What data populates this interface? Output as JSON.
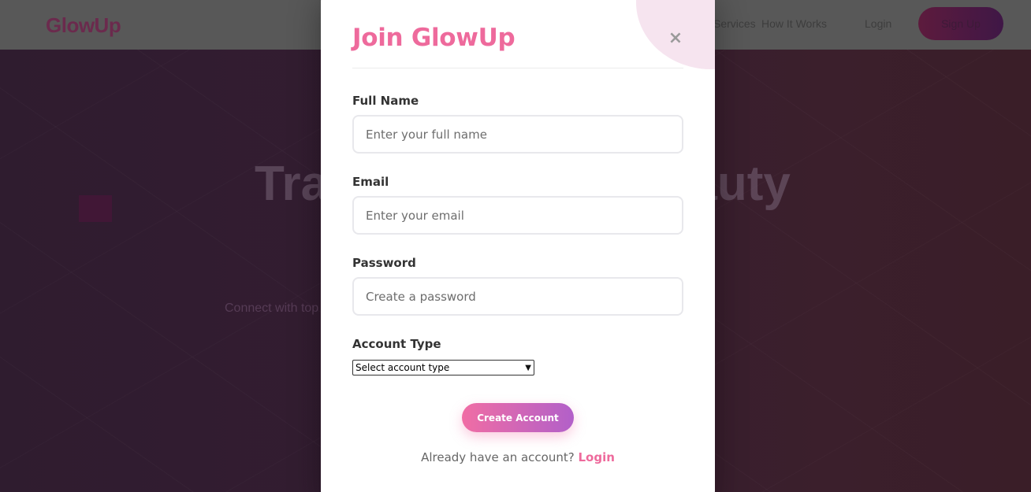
{
  "navbar": {
    "logo": "GlowUp",
    "links": [
      "Services",
      "How It Works",
      "Login"
    ],
    "signup_label": "Sign Up"
  },
  "hero": {
    "title": "Transform Your Beauty",
    "subtitle": "Connect with top beauty professionals and book appointments for"
  },
  "modal": {
    "title": "Join GlowUp",
    "close_symbol": "×",
    "fields": {
      "full_name": {
        "label": "Full Name",
        "placeholder": "Enter your full name"
      },
      "email": {
        "label": "Email",
        "placeholder": "Enter your email"
      },
      "password": {
        "label": "Password",
        "placeholder": "Create a password"
      },
      "account_type": {
        "label": "Account Type",
        "selected": "Select account type"
      }
    },
    "submit_label": "Create Account",
    "footer_prompt": "Already have an account?",
    "login_link": "Login"
  },
  "colors": {
    "accent_pink": "#ee6a9c",
    "gradient_start": "#f06da4",
    "gradient_end": "#b260c9"
  },
  "icons": {
    "close": "close-icon",
    "select_chevron": "chevron-down-icon"
  }
}
